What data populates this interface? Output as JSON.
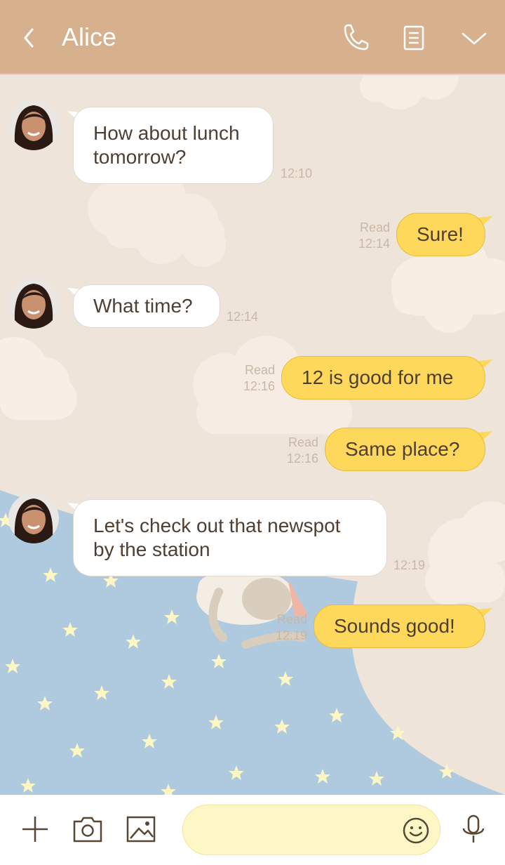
{
  "header": {
    "title": "Alice",
    "background": "#d7b08d",
    "icons": [
      "back-chevron-icon",
      "phone-icon",
      "notes-icon",
      "chevron-down-icon"
    ]
  },
  "messages": [
    {
      "side": "in",
      "lines": [
        "How about lunch",
        "tomorrow?"
      ],
      "time": "12:10"
    },
    {
      "side": "out",
      "text": "Sure!",
      "read": "Read",
      "time": "12:14"
    },
    {
      "side": "in",
      "text": "What time?",
      "time": "12:14"
    },
    {
      "side": "out",
      "text": "12 is good for me",
      "read": "Read",
      "time": "12:16"
    },
    {
      "side": "out",
      "text": "Same place?",
      "read": "Read",
      "time": "12:16"
    },
    {
      "side": "in",
      "lines": [
        "Let's check out that newspot",
        "by the station"
      ],
      "time": "12:19"
    },
    {
      "side": "out",
      "text": "Sounds good!",
      "read": "Read",
      "time": "12:19"
    }
  ],
  "footer": {
    "input_value": "",
    "icons": [
      "plus-icon",
      "camera-icon",
      "image-icon",
      "emoji-icon",
      "microphone-icon"
    ]
  },
  "colors": {
    "outgoing_bubble": "#fdd85a",
    "incoming_bubble": "#ffffff",
    "text": "#4f3f33",
    "timestamp": "#c9b7a6",
    "sky_blue": "#afcade"
  }
}
